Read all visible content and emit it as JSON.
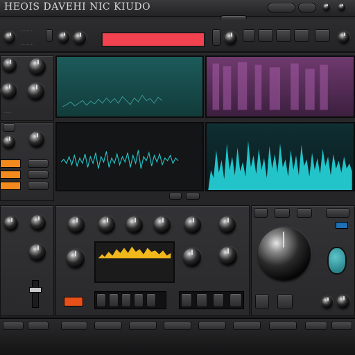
{
  "window": {
    "title": "HEOIS DAVEHI NIC KIUDO"
  },
  "header": {
    "pills": [
      "",
      "",
      "",
      "",
      ""
    ],
    "badge": ""
  },
  "colors": {
    "accent_red": "#f2414f",
    "teal": "#1f5e5e",
    "purple": "#7b3f7a",
    "cyan": "#22c4c9",
    "orange": "#f28a1e",
    "yellow": "#f0b81a"
  },
  "icons": [
    "power-icon",
    "gear-icon",
    "dot-icon"
  ]
}
